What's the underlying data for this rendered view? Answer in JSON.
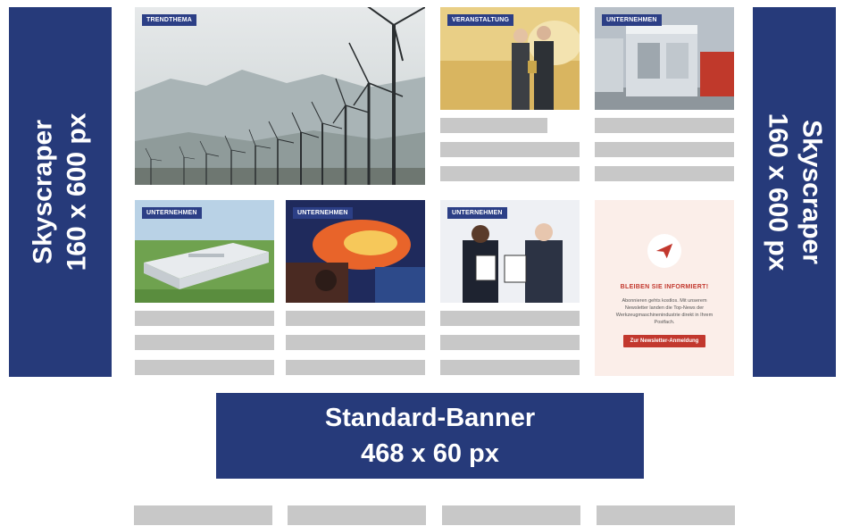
{
  "skyscraper_left": {
    "line1": "Skyscraper",
    "line2": "160 x 600 px"
  },
  "skyscraper_right": {
    "line1": "Skyscraper",
    "line2": "160 x 600 px"
  },
  "banner": {
    "line1": "Standard-Banner",
    "line2": "468 x 60 px"
  },
  "articles": {
    "feature": {
      "tag": "TRENDTHEMA"
    },
    "event": {
      "tag": "VERANSTALTUNG"
    },
    "company1": {
      "tag": "UNTERNEHMEN"
    },
    "company2": {
      "tag": "UNTERNEHMEN"
    },
    "company3": {
      "tag": "UNTERNEHMEN"
    },
    "company4": {
      "tag": "UNTERNEHMEN"
    }
  },
  "newsletter": {
    "title": "BLEIBEN SIE INFORMIERT!",
    "text": "Abonnieren gehts kostlos. Mit unserem Newsletter landen die Top-News der Werkzeugmaschinenindustrie direkt in Ihrem Postfach.",
    "button": "Zur Newsletter-Anmeldung"
  },
  "colors": {
    "navy": "#263a7a",
    "placeholder": "#c8c8c8",
    "newsletter_bg": "#fbeee9",
    "accent_red": "#c2382e"
  }
}
